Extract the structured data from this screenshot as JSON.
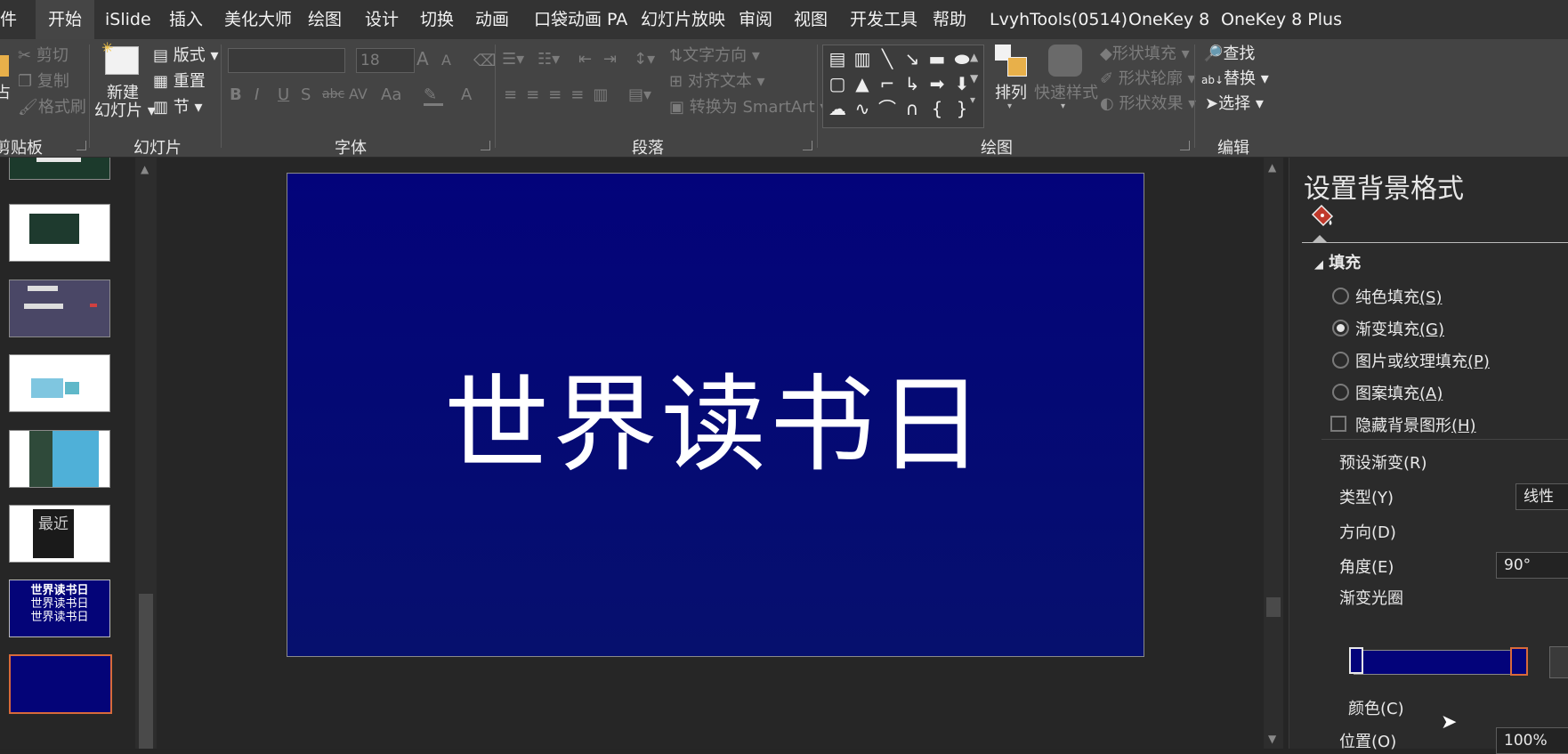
{
  "tabs": [
    {
      "label": "件"
    },
    {
      "label": "开始",
      "active": true
    },
    {
      "label": "iSlide"
    },
    {
      "label": "插入"
    },
    {
      "label": "美化大师"
    },
    {
      "label": "绘图"
    },
    {
      "label": "设计"
    },
    {
      "label": "切换"
    },
    {
      "label": "动画"
    },
    {
      "label": "口袋动画 PA"
    },
    {
      "label": "幻灯片放映"
    },
    {
      "label": "审阅"
    },
    {
      "label": "视图"
    },
    {
      "label": "开发工具"
    },
    {
      "label": "帮助"
    },
    {
      "label": "LvyhTools(0514)"
    },
    {
      "label": "OneKey 8"
    },
    {
      "label": "OneKey 8 Plus"
    }
  ],
  "ribbon": {
    "clipboard": {
      "cut": "剪切",
      "copy": "复制",
      "format_painter": "格式刷",
      "paste_fragment": "占",
      "label": "剪贴板"
    },
    "slides": {
      "new_slide_line1": "新建",
      "new_slide_line2": "幻灯片",
      "layout": "版式",
      "reset": "重置",
      "section": "节",
      "label": "幻灯片"
    },
    "font": {
      "font_name": "",
      "font_size": "18",
      "label": "字体",
      "grow": "A",
      "shrink": "A",
      "bold": "B",
      "italic": "I",
      "underline": "U",
      "shadow": "S",
      "strike": "abc",
      "spacing": "AV",
      "case": "Aa",
      "color": "A"
    },
    "paragraph": {
      "text_direction": "文字方向",
      "align_text": "对齐文本",
      "smartart": "转换为 SmartArt",
      "label": "段落"
    },
    "drawing": {
      "arrange": "排列",
      "quick_styles": "快速样式",
      "shape_fill": "形状填充",
      "shape_outline": "形状轮廓",
      "shape_effects": "形状效果",
      "label": "绘图"
    },
    "editing": {
      "find": "查找",
      "replace": "替换",
      "select": "选择",
      "label": "编辑"
    }
  },
  "thumbnails": [
    {
      "kind": "forest-top"
    },
    {
      "kind": "forest-card"
    },
    {
      "kind": "purple"
    },
    {
      "kind": "white-blue"
    },
    {
      "kind": "teal-collage"
    },
    {
      "kind": "dark-poster",
      "text": "最近"
    },
    {
      "kind": "navy-text",
      "lines": [
        "世界读书日",
        "世界读书日",
        "世界读书日"
      ]
    },
    {
      "kind": "navy-selected"
    }
  ],
  "slide": {
    "title": "世界读书日",
    "bg_top": "#03037a",
    "bg_bottom": "#06106e"
  },
  "pane": {
    "title": "设置背景格式",
    "fill_section": "填充",
    "options": [
      {
        "label": "纯色填充",
        "key": "(S)",
        "checked": false
      },
      {
        "label": "渐变填充",
        "key": "(G)",
        "checked": true
      },
      {
        "label": "图片或纹理填充",
        "key": "(P)",
        "checked": false
      },
      {
        "label": "图案填充",
        "key": "(A)",
        "checked": false
      }
    ],
    "hide_bg": {
      "label": "隐藏背景图形",
      "key": "(H)",
      "checked": false
    },
    "preset_gradient": "预设渐变(R)",
    "type_label": "类型(Y)",
    "type_value": "线性",
    "direction_label": "方向(D)",
    "angle_label": "角度(E)",
    "angle_value": "90°",
    "stops_label": "渐变光圈",
    "color_label": "颜色(C)",
    "position_label": "位置(O)",
    "position_value": "100%",
    "accent": "#c0392b"
  }
}
